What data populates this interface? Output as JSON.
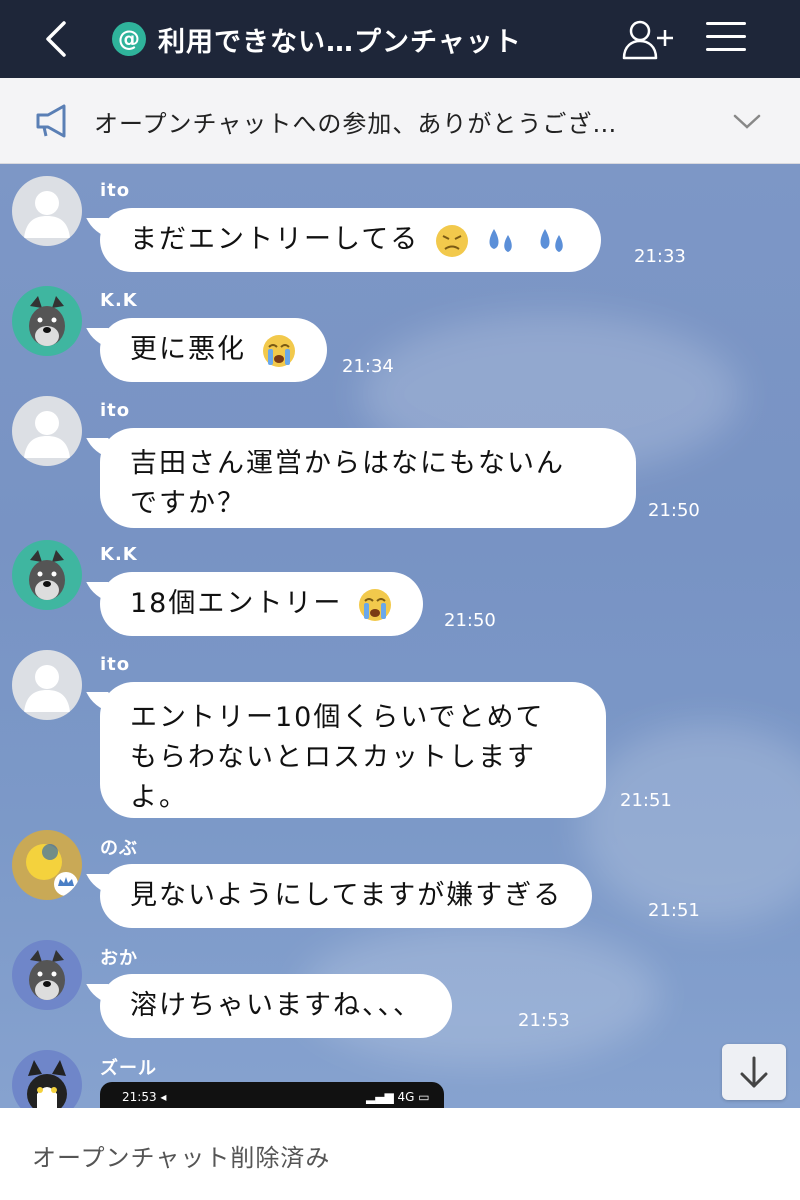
{
  "header": {
    "back_icon": "chevron-left-icon",
    "badge": "@",
    "title": "利用できない…プンチャット",
    "add_friend_icon": "add-user-icon",
    "menu_icon": "hamburger-icon"
  },
  "notice": {
    "icon": "megaphone-icon",
    "text": "オープンチャットへの参加、ありがとうござ…",
    "chevron_icon": "chevron-down-icon"
  },
  "messages": [
    {
      "sender": "ito",
      "text": "まだエントリーしてる",
      "time": "21:33"
    },
    {
      "sender": "K.K",
      "text": "更に悪化",
      "time": "21:34"
    },
    {
      "sender": "ito",
      "line1": "吉田さん運営からはなにもないん",
      "line2": "ですか？",
      "time": "21:50"
    },
    {
      "sender": "K.K",
      "text": "18個エントリー",
      "time": "21:50"
    },
    {
      "sender": "ito",
      "line1": "エントリー10個くらいでとめて",
      "line2": "もらわないとロスカットします",
      "line3": "よ。",
      "time": "21:51"
    },
    {
      "sender": "のぶ",
      "text": "見ないようにしてますが嫌すぎる",
      "time": "21:51"
    },
    {
      "sender": "おか",
      "text": "溶けちゃいますね、、、",
      "time": "21:53"
    },
    {
      "sender": "ズール",
      "shot_time": "21:53 ◂",
      "shot_status": "▂▄▆ 4G ▭"
    }
  ],
  "scroll_icon": "arrow-down-icon",
  "footer": {
    "status": "オープンチャット削除済み"
  },
  "colors": {
    "header_bg": "#1e2639",
    "chat_bg": "#7a95c4",
    "badge": "#2fb39b"
  }
}
